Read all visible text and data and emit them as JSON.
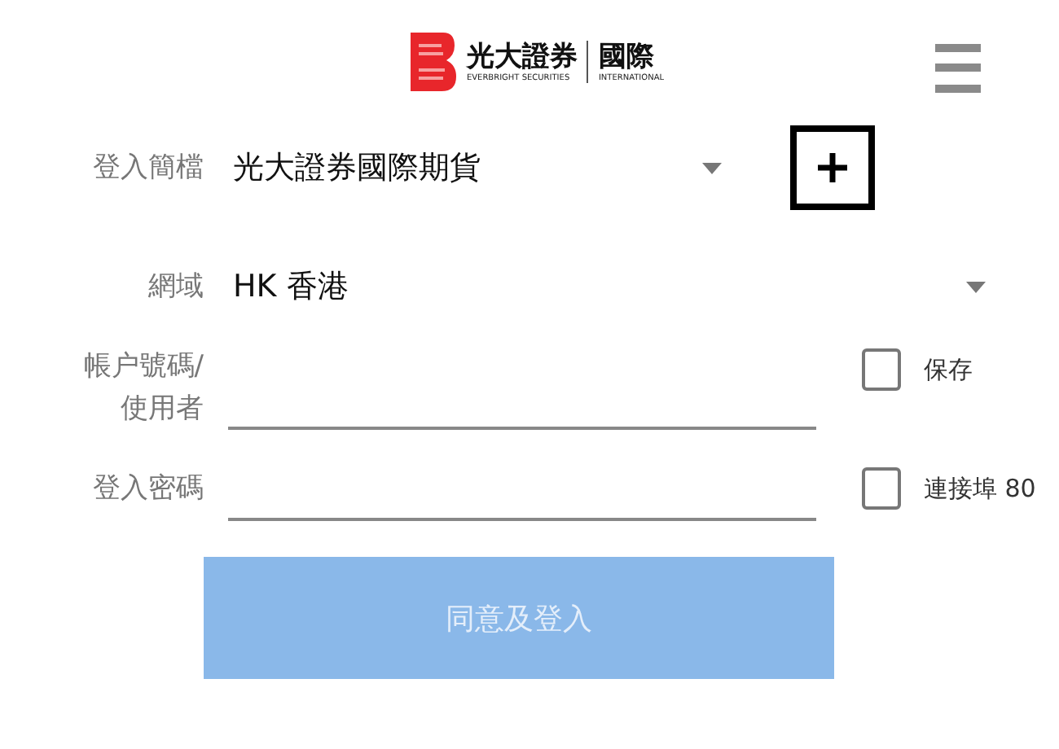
{
  "header": {
    "logo": {
      "name_zh": "光大證券",
      "name_en": "EVERBRIGHT SECURITIES",
      "suffix_zh": "國際",
      "suffix_en": "INTERNATIONAL"
    }
  },
  "form": {
    "profile": {
      "label": "登入簡檔",
      "value": "光大證券國際期貨"
    },
    "domain": {
      "label": "網域",
      "value": "HK 香港"
    },
    "account": {
      "label": "帳户號碼/\n使用者",
      "checkbox": {
        "label": "保存",
        "checked": false
      }
    },
    "password": {
      "label": "登入密碼",
      "checkbox": {
        "label": "連接埠 80",
        "checked": false
      }
    },
    "submit": {
      "label": "同意及登入",
      "disabled": true
    }
  }
}
